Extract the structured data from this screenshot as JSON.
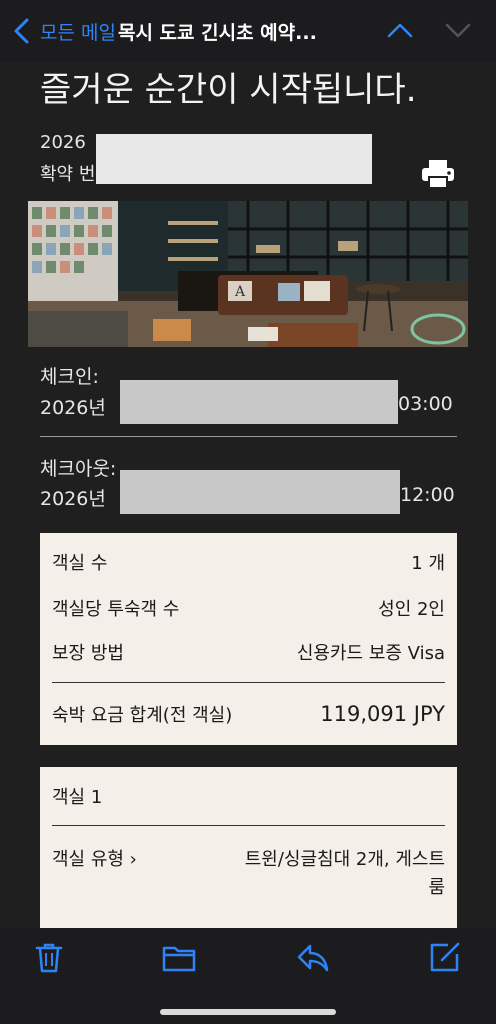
{
  "nav": {
    "back_label": "모든 메일",
    "subject": "목시 도쿄 긴시초 예약..."
  },
  "email": {
    "headline": "즐거운 순간이 시작됩니다.",
    "dates_prefix": "2026",
    "booking_prefix": "확약 번"
  },
  "checkin": {
    "label": "체크인:",
    "year": "2026년",
    "time": "03:00"
  },
  "checkout": {
    "label": "체크아웃:",
    "year": "2026년",
    "time": "12:00"
  },
  "summary": {
    "rooms_label": "객실 수",
    "rooms_value": "1 개",
    "guests_label": "객실당 투숙객 수",
    "guests_value": "성인 2인",
    "guarantee_label": "보장 방법",
    "guarantee_value": "신용카드 보증 Visa",
    "total_label": "숙박 요금 합계(전 객실)",
    "total_value": "119,091 JPY"
  },
  "room1": {
    "title": "객실 1",
    "type_label": "객실 유형 ›",
    "type_value_line1": "트윈/싱글침대 2개, 게스트",
    "type_value_line2": "룸"
  },
  "colors": {
    "accent": "#2e84f7",
    "card_bg": "#f5efea",
    "bar_bg": "#1c1c1e"
  },
  "icons": [
    "chevron-left-icon",
    "chevron-up-icon",
    "chevron-down-icon",
    "print-icon",
    "trash-icon",
    "folder-icon",
    "reply-icon",
    "compose-icon"
  ]
}
